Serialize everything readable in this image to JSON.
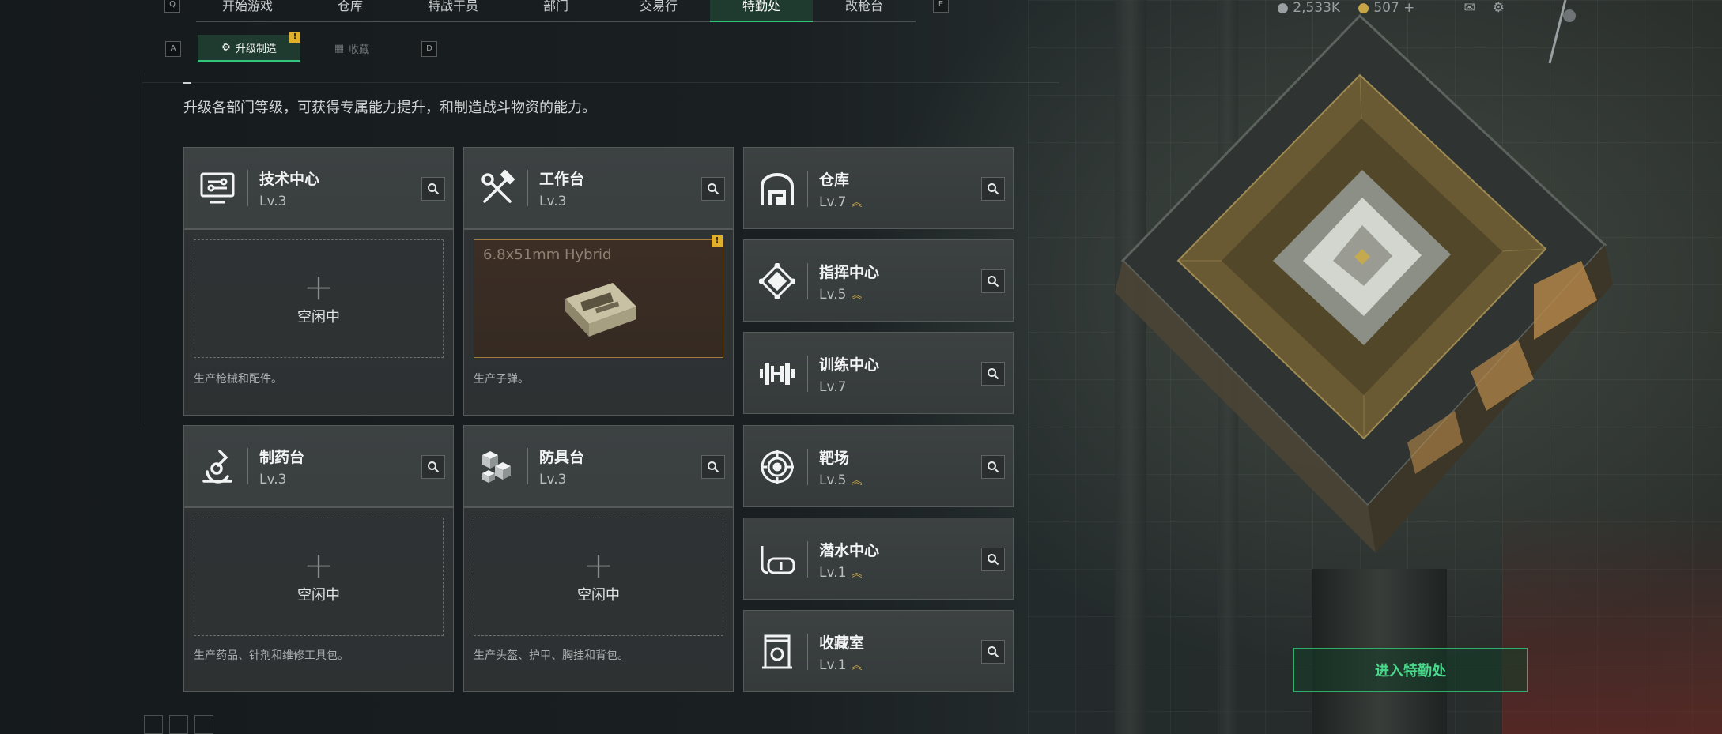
{
  "top_nav": {
    "left_key": "Q",
    "right_key": "E",
    "tabs": [
      {
        "label": "开始游戏",
        "active": false
      },
      {
        "label": "仓库",
        "active": false
      },
      {
        "label": "特战干员",
        "active": false
      },
      {
        "label": "部门",
        "active": false
      },
      {
        "label": "交易行",
        "active": false
      },
      {
        "label": "特勤处",
        "active": true
      },
      {
        "label": "改枪台",
        "active": false
      }
    ],
    "currency_1": "2,533K",
    "currency_2": "507 +"
  },
  "sub_tabs": {
    "left_key": "A",
    "right_key": "D",
    "tabs": [
      {
        "label": "升级制造",
        "active": true,
        "badge": "!"
      },
      {
        "label": "收藏",
        "active": false
      }
    ]
  },
  "description": "升级各部门等级，可获得专属能力提升，和制造战斗物资的能力。",
  "facilities_with_slot": [
    {
      "name": "技术中心",
      "level": "Lv.3",
      "status": "空闲中",
      "note": "生产枪械和配件。",
      "icon": "tech-center-icon"
    },
    {
      "name": "工作台",
      "level": "Lv.3",
      "status": "6.8x51mm Hybrid",
      "note": "生产子弹。",
      "icon": "workbench-icon",
      "producing": true,
      "badge": "!"
    },
    {
      "name": "制药台",
      "level": "Lv.3",
      "status": "空闲中",
      "note": "生产药品、针剂和维修工具包。",
      "icon": "pharmacy-icon"
    },
    {
      "name": "防具台",
      "level": "Lv.3",
      "status": "空闲中",
      "note": "生产头盔、护甲、胸挂和背包。",
      "icon": "armor-bench-icon"
    }
  ],
  "facilities_list": [
    {
      "name": "仓库",
      "level": "Lv.7",
      "upgradable": true,
      "icon": "warehouse-icon"
    },
    {
      "name": "指挥中心",
      "level": "Lv.5",
      "upgradable": true,
      "icon": "command-center-icon"
    },
    {
      "name": "训练中心",
      "level": "Lv.7",
      "upgradable": false,
      "icon": "training-center-icon"
    },
    {
      "name": "靶场",
      "level": "Lv.5",
      "upgradable": true,
      "icon": "shooting-range-icon"
    },
    {
      "name": "潜水中心",
      "level": "Lv.1",
      "upgradable": true,
      "icon": "diving-center-icon"
    },
    {
      "name": "收藏室",
      "level": "Lv.1",
      "upgradable": true,
      "icon": "collection-room-icon"
    }
  ],
  "enter_button": "进入特勤处",
  "colors": {
    "accent_green": "#35c47b",
    "upgrade_gold": "#c8a646",
    "alert_yellow": "#e0b02c"
  }
}
